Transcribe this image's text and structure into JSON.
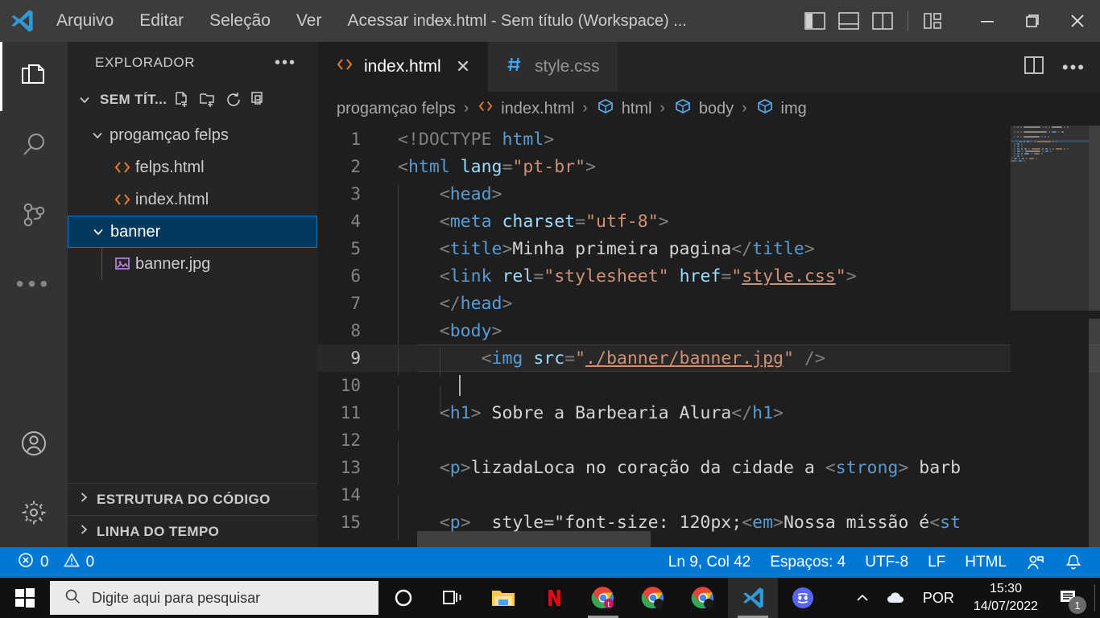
{
  "titlebar": {
    "logo_icon": "vscode-logo-icon",
    "menu": [
      {
        "label": "Arquivo",
        "name": "menu-arquivo"
      },
      {
        "label": "Editar",
        "name": "menu-editar"
      },
      {
        "label": "Seleção",
        "name": "menu-selecao"
      },
      {
        "label": "Ver",
        "name": "menu-ver"
      },
      {
        "label": "Acessar",
        "name": "menu-acessar"
      },
      {
        "label": "···",
        "name": "menu-more"
      }
    ],
    "window_title": "index.html - Sem título (Workspace) ...",
    "layout_controls": [
      "toggle-primary-sidebar-icon",
      "toggle-panel-icon",
      "toggle-secondary-sidebar-icon",
      "customize-layout-icon"
    ],
    "window_buttons": {
      "minimize": "−",
      "maximize": "❐",
      "close": "✕"
    }
  },
  "activitybar": {
    "items": [
      {
        "name": "activity-explorer",
        "icon": "files-icon",
        "active": true
      },
      {
        "name": "activity-search",
        "icon": "search-icon",
        "active": false
      },
      {
        "name": "activity-source-control",
        "icon": "source-control-icon",
        "active": false
      },
      {
        "name": "activity-more",
        "icon": "ellipsis-icon",
        "active": false
      }
    ],
    "bottom": [
      {
        "name": "activity-accounts",
        "icon": "account-icon"
      },
      {
        "name": "activity-settings",
        "icon": "gear-icon"
      }
    ]
  },
  "sidebar": {
    "header_title": "EXPLORADOR",
    "header_actions_icon": "ellipsis-icon",
    "workspace": {
      "label": "SEM TÍT...",
      "actions": [
        "new-file-icon",
        "new-folder-icon",
        "refresh-icon",
        "collapse-all-icon"
      ]
    },
    "tree": [
      {
        "label": "progamçao felps",
        "type": "folder",
        "expanded": true,
        "indent": 1,
        "name": "tree-folder-progamcao-felps"
      },
      {
        "label": "felps.html",
        "type": "html",
        "indent": 2,
        "name": "tree-file-felps-html"
      },
      {
        "label": "index.html",
        "type": "html",
        "indent": 2,
        "name": "tree-file-index-html"
      },
      {
        "label": "banner",
        "type": "folder",
        "expanded": true,
        "indent": 1,
        "selected": true,
        "name": "tree-folder-banner"
      },
      {
        "label": "banner.jpg",
        "type": "image",
        "indent": 2,
        "name": "tree-file-banner-jpg"
      }
    ],
    "collapsed_sections": [
      {
        "label": "ESTRUTURA DO CÓDIGO",
        "name": "section-outline"
      },
      {
        "label": "LINHA DO TEMPO",
        "name": "section-timeline"
      }
    ]
  },
  "editor": {
    "tabs": [
      {
        "label": "index.html",
        "icon": "html-file-icon",
        "active": true,
        "closable": true,
        "name": "tab-index-html"
      },
      {
        "label": "style.css",
        "icon": "css-file-icon",
        "active": false,
        "closable": false,
        "name": "tab-style-css"
      }
    ],
    "tab_actions": [
      "split-editor-icon",
      "more-actions-icon"
    ],
    "breadcrumb": [
      {
        "label": "progamçao felps",
        "icon": null
      },
      {
        "label": "index.html",
        "icon": "html-file-icon"
      },
      {
        "label": "html",
        "icon": "symbol-field-icon"
      },
      {
        "label": "body",
        "icon": "symbol-field-icon"
      },
      {
        "label": "img",
        "icon": "symbol-field-icon"
      }
    ],
    "breadcrumb_separator": "›",
    "lines": [
      {
        "n": 1,
        "current": false,
        "guides": 0,
        "tokens": [
          {
            "t": "<!DOCTYPE ",
            "c": "brk"
          },
          {
            "t": "html",
            "c": "tag"
          },
          {
            "t": ">",
            "c": "brk"
          }
        ]
      },
      {
        "n": 2,
        "current": false,
        "guides": 0,
        "tokens": [
          {
            "t": "<",
            "c": "brk"
          },
          {
            "t": "html",
            "c": "tag"
          },
          {
            "t": " ",
            "c": "txt"
          },
          {
            "t": "lang",
            "c": "attr"
          },
          {
            "t": "=",
            "c": "brk"
          },
          {
            "t": "\"pt-br\"",
            "c": "str"
          },
          {
            "t": ">",
            "c": "brk"
          }
        ]
      },
      {
        "n": 3,
        "current": false,
        "guides": 1,
        "tokens": [
          {
            "t": "    ",
            "c": "txt"
          },
          {
            "t": "<",
            "c": "brk"
          },
          {
            "t": "head",
            "c": "tag"
          },
          {
            "t": ">",
            "c": "brk"
          }
        ]
      },
      {
        "n": 4,
        "current": false,
        "guides": 1,
        "tokens": [
          {
            "t": "    ",
            "c": "txt"
          },
          {
            "t": "<",
            "c": "brk"
          },
          {
            "t": "meta",
            "c": "tag"
          },
          {
            "t": " ",
            "c": "txt"
          },
          {
            "t": "charset",
            "c": "attr"
          },
          {
            "t": "=",
            "c": "brk"
          },
          {
            "t": "\"utf-8\"",
            "c": "str"
          },
          {
            "t": ">",
            "c": "brk"
          }
        ]
      },
      {
        "n": 5,
        "current": false,
        "guides": 1,
        "tokens": [
          {
            "t": "    ",
            "c": "txt"
          },
          {
            "t": "<",
            "c": "brk"
          },
          {
            "t": "title",
            "c": "tag"
          },
          {
            "t": ">",
            "c": "brk"
          },
          {
            "t": "Minha primeira pagina",
            "c": "txt"
          },
          {
            "t": "</",
            "c": "brk"
          },
          {
            "t": "title",
            "c": "tag"
          },
          {
            "t": ">",
            "c": "brk"
          }
        ]
      },
      {
        "n": 6,
        "current": false,
        "guides": 1,
        "tokens": [
          {
            "t": "    ",
            "c": "txt"
          },
          {
            "t": "<",
            "c": "brk"
          },
          {
            "t": "link",
            "c": "tag"
          },
          {
            "t": " ",
            "c": "txt"
          },
          {
            "t": "rel",
            "c": "attr"
          },
          {
            "t": "=",
            "c": "brk"
          },
          {
            "t": "\"stylesheet\"",
            "c": "str"
          },
          {
            "t": " ",
            "c": "txt"
          },
          {
            "t": "href",
            "c": "attr"
          },
          {
            "t": "=",
            "c": "brk"
          },
          {
            "t": "\"",
            "c": "str"
          },
          {
            "t": "style.css",
            "c": "str link"
          },
          {
            "t": "\"",
            "c": "str"
          },
          {
            "t": ">",
            "c": "brk"
          }
        ]
      },
      {
        "n": 7,
        "current": false,
        "guides": 1,
        "tokens": [
          {
            "t": "    ",
            "c": "txt"
          },
          {
            "t": "</",
            "c": "brk"
          },
          {
            "t": "head",
            "c": "tag"
          },
          {
            "t": ">",
            "c": "brk"
          }
        ]
      },
      {
        "n": 8,
        "current": false,
        "guides": 1,
        "tokens": [
          {
            "t": "    ",
            "c": "txt"
          },
          {
            "t": "<",
            "c": "brk"
          },
          {
            "t": "body",
            "c": "tag"
          },
          {
            "t": ">",
            "c": "brk"
          }
        ]
      },
      {
        "n": 9,
        "current": true,
        "guides": 2,
        "tokens": [
          {
            "t": "        ",
            "c": "txt"
          },
          {
            "t": "<",
            "c": "brk"
          },
          {
            "t": "img",
            "c": "tag"
          },
          {
            "t": " ",
            "c": "txt"
          },
          {
            "t": "src",
            "c": "attr"
          },
          {
            "t": "=",
            "c": "brk"
          },
          {
            "t": "\"",
            "c": "str"
          },
          {
            "t": "./banner/banner.jpg",
            "c": "str link"
          },
          {
            "t": "\"",
            "c": "str"
          },
          {
            "t": " />",
            "c": "brk"
          }
        ]
      },
      {
        "n": 10,
        "current": false,
        "guides": 2,
        "tokens": []
      },
      {
        "n": 11,
        "current": false,
        "guides": 1,
        "tokens": [
          {
            "t": "    ",
            "c": "txt"
          },
          {
            "t": "<",
            "c": "brk"
          },
          {
            "t": "h1",
            "c": "tag"
          },
          {
            "t": ">",
            "c": "brk"
          },
          {
            "t": " Sobre a Barbearia Alura",
            "c": "txt"
          },
          {
            "t": "</",
            "c": "brk"
          },
          {
            "t": "h1",
            "c": "tag"
          },
          {
            "t": ">",
            "c": "brk"
          }
        ]
      },
      {
        "n": 12,
        "current": false,
        "guides": 1,
        "tokens": []
      },
      {
        "n": 13,
        "current": false,
        "guides": 1,
        "tokens": [
          {
            "t": "    ",
            "c": "txt"
          },
          {
            "t": "<",
            "c": "brk"
          },
          {
            "t": "p",
            "c": "tag"
          },
          {
            "t": ">",
            "c": "brk"
          },
          {
            "t": "lizadaLoca no coração da cidade a ",
            "c": "txt"
          },
          {
            "t": "<",
            "c": "brk"
          },
          {
            "t": "strong",
            "c": "tag"
          },
          {
            "t": ">",
            "c": "brk"
          },
          {
            "t": " barb",
            "c": "txt"
          }
        ]
      },
      {
        "n": 14,
        "current": false,
        "guides": 1,
        "tokens": []
      },
      {
        "n": 15,
        "current": false,
        "guides": 1,
        "tokens": [
          {
            "t": "    ",
            "c": "txt"
          },
          {
            "t": "<",
            "c": "brk"
          },
          {
            "t": "p",
            "c": "tag"
          },
          {
            "t": "> ",
            "c": "brk"
          },
          {
            "t": " style=\"font-size: 120px;",
            "c": "txt"
          },
          {
            "t": "<",
            "c": "brk"
          },
          {
            "t": "em",
            "c": "tag"
          },
          {
            "t": ">",
            "c": "brk"
          },
          {
            "t": "Nossa missão é",
            "c": "txt"
          },
          {
            "t": "<",
            "c": "brk"
          },
          {
            "t": "st",
            "c": "tag"
          }
        ]
      }
    ]
  },
  "statusbar": {
    "left": [
      {
        "icon": "error-icon",
        "label": "0",
        "name": "status-errors"
      },
      {
        "icon": "warning-icon",
        "label": "0",
        "name": "status-warnings"
      }
    ],
    "right": [
      {
        "label": "Ln 9, Col 42",
        "name": "status-cursor-position"
      },
      {
        "label": "Espaços: 4",
        "name": "status-indentation"
      },
      {
        "label": "UTF-8",
        "name": "status-encoding"
      },
      {
        "label": "LF",
        "name": "status-eol"
      },
      {
        "label": "HTML",
        "name": "status-language-mode"
      }
    ],
    "right_icons": [
      {
        "icon": "live-share-icon",
        "name": "status-live-share"
      },
      {
        "icon": "bell-icon",
        "name": "status-notifications"
      }
    ],
    "accent_color": "#0078d4"
  },
  "taskbar": {
    "start_icon": "windows-start-icon",
    "search_placeholder": "Digite aqui para pesquisar",
    "search_icon": "search-icon",
    "icons": [
      {
        "name": "taskbar-cortana",
        "icon": "cortana-circle-icon"
      },
      {
        "name": "taskbar-task-view",
        "icon": "task-view-icon"
      },
      {
        "name": "taskbar-file-explorer",
        "icon": "folder-icon",
        "running": false
      },
      {
        "name": "taskbar-netflix",
        "icon": "netflix-icon",
        "running": false
      },
      {
        "name": "taskbar-chrome-1",
        "icon": "chrome-icon",
        "running": true
      },
      {
        "name": "taskbar-chrome-2",
        "icon": "chrome-icon",
        "running": false
      },
      {
        "name": "taskbar-chrome-3",
        "icon": "chrome-icon",
        "running": false
      },
      {
        "name": "taskbar-vscode",
        "icon": "vscode-logo-icon",
        "running": true,
        "active": true
      },
      {
        "name": "taskbar-discord",
        "icon": "discord-icon",
        "running": false
      }
    ],
    "tray": {
      "expand_icon": "chevron-up-icon",
      "onedrive_icon": "onedrive-cloud-icon",
      "language": "POR",
      "time": "15:30",
      "date": "14/07/2022",
      "notification_icon": "action-center-icon",
      "notification_count": "1"
    }
  }
}
